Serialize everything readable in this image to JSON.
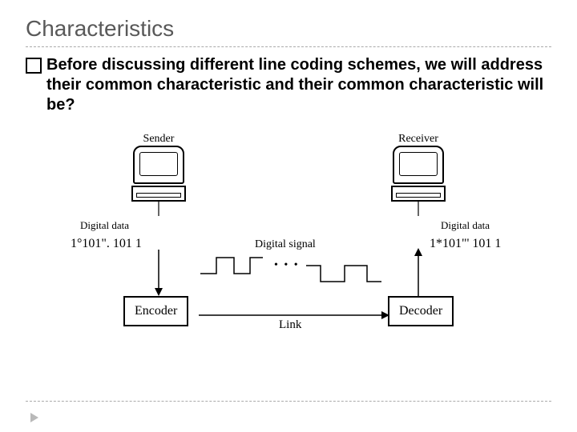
{
  "title": "Characteristics",
  "body": "Before discussing different line coding schemes, we will address their common characteristic and their common characteristic will be?",
  "diagram": {
    "sender_label": "Sender",
    "receiver_label": "Receiver",
    "digital_data_left": "Digital data",
    "digital_data_right": "Digital data",
    "bits_left": "1°101\". 101 1",
    "bits_right": "1*101\"' 101 1",
    "encoder_label": "Encoder",
    "decoder_label": "Decoder",
    "signal_label": "Digital signal",
    "link_label": "Link",
    "dots": "• • •"
  }
}
